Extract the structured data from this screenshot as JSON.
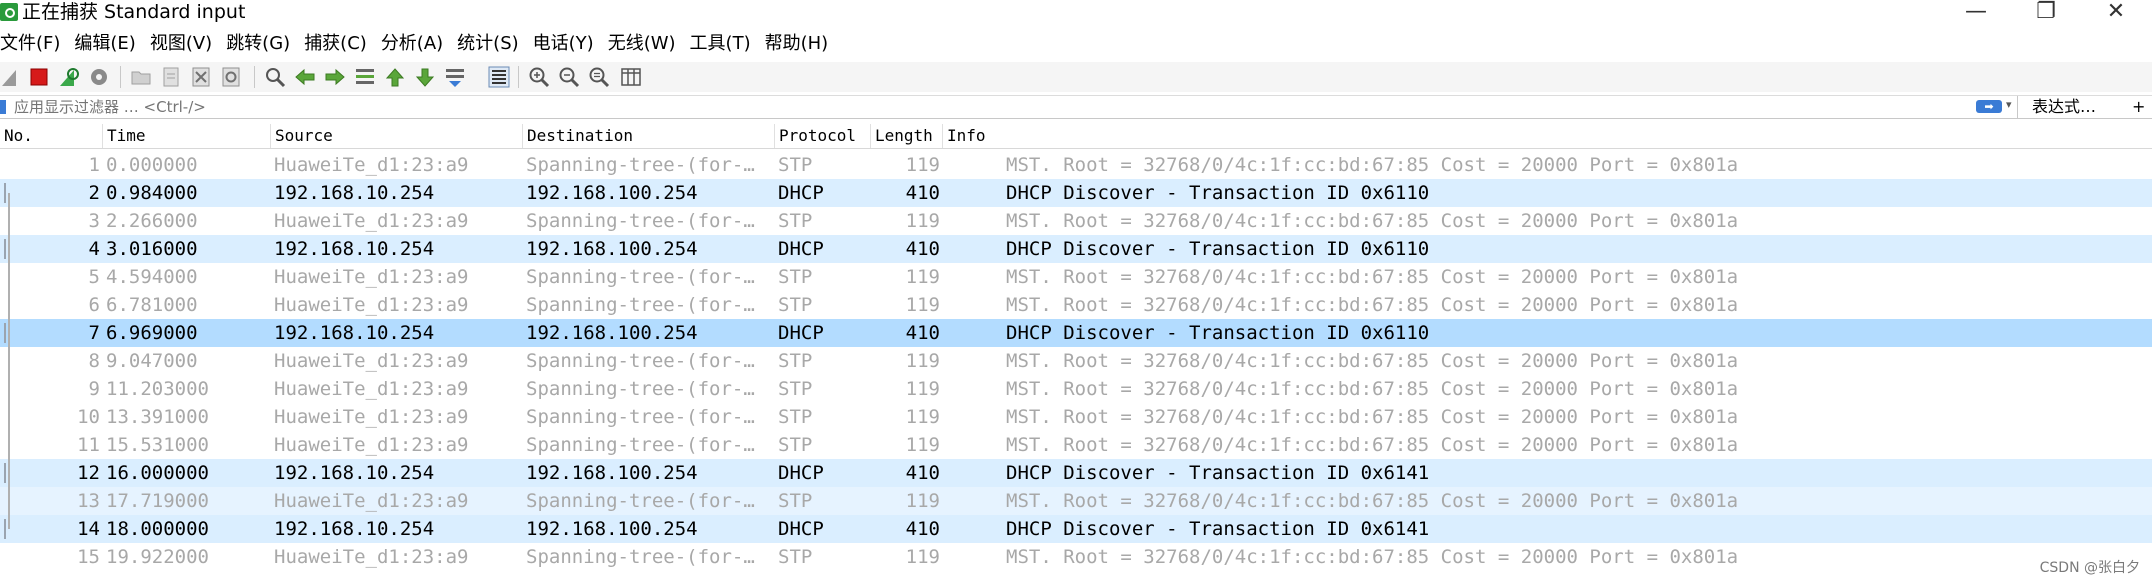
{
  "window": {
    "title": "正在捕获 Standard input",
    "min_glyph": "—",
    "max_glyph": "❐",
    "close_glyph": "✕"
  },
  "menu": [
    "文件(F)",
    "编辑(E)",
    "视图(V)",
    "跳转(G)",
    "捕获(C)",
    "分析(A)",
    "统计(S)",
    "电话(Y)",
    "无线(W)",
    "工具(T)",
    "帮助(H)"
  ],
  "toolbar": {
    "icons": [
      "shark-fin-start-icon",
      "stop-capture-icon",
      "restart-capture-icon",
      "capture-options-icon",
      "open-file-icon",
      "save-file-icon",
      "close-file-icon",
      "reload-file-icon",
      "find-packet-icon",
      "go-back-icon",
      "go-forward-icon",
      "go-to-packet-icon",
      "go-first-icon",
      "go-last-icon",
      "auto-scroll-icon",
      "colorize-icon",
      "zoom-in-icon",
      "zoom-out-icon",
      "normal-size-icon",
      "resize-columns-icon"
    ]
  },
  "filter": {
    "placeholder": "应用显示过滤器 … <Ctrl-/>",
    "expression_label": "表达式…",
    "plus_label": "+"
  },
  "columns": [
    "No.",
    "Time",
    "Source",
    "Destination",
    "Protocol",
    "Length",
    "Info"
  ],
  "packets": [
    {
      "no": "1",
      "time": "0.000000",
      "src": "HuaweiTe_d1:23:a9",
      "dst": "Spanning-tree-(for-…",
      "proto": "STP",
      "len": "119",
      "info": "MST. Root = 32768/0/4c:1f:cc:bd:67:85  Cost = 20000  Port = 0x801a",
      "kind": "stp"
    },
    {
      "no": "2",
      "time": "0.984000",
      "src": "192.168.10.254",
      "dst": "192.168.100.254",
      "proto": "DHCP",
      "len": "410",
      "info": "DHCP Discover - Transaction ID 0x6110",
      "kind": "dhcp"
    },
    {
      "no": "3",
      "time": "2.266000",
      "src": "HuaweiTe_d1:23:a9",
      "dst": "Spanning-tree-(for-…",
      "proto": "STP",
      "len": "119",
      "info": "MST. Root = 32768/0/4c:1f:cc:bd:67:85  Cost = 20000  Port = 0x801a",
      "kind": "stp"
    },
    {
      "no": "4",
      "time": "3.016000",
      "src": "192.168.10.254",
      "dst": "192.168.100.254",
      "proto": "DHCP",
      "len": "410",
      "info": "DHCP Discover - Transaction ID 0x6110",
      "kind": "dhcp"
    },
    {
      "no": "5",
      "time": "4.594000",
      "src": "HuaweiTe_d1:23:a9",
      "dst": "Spanning-tree-(for-…",
      "proto": "STP",
      "len": "119",
      "info": "MST. Root = 32768/0/4c:1f:cc:bd:67:85  Cost = 20000  Port = 0x801a",
      "kind": "stp"
    },
    {
      "no": "6",
      "time": "6.781000",
      "src": "HuaweiTe_d1:23:a9",
      "dst": "Spanning-tree-(for-…",
      "proto": "STP",
      "len": "119",
      "info": "MST. Root = 32768/0/4c:1f:cc:bd:67:85  Cost = 20000  Port = 0x801a",
      "kind": "stp"
    },
    {
      "no": "7",
      "time": "6.969000",
      "src": "192.168.10.254",
      "dst": "192.168.100.254",
      "proto": "DHCP",
      "len": "410",
      "info": "DHCP Discover - Transaction ID 0x6110",
      "kind": "selected"
    },
    {
      "no": "8",
      "time": "9.047000",
      "src": "HuaweiTe_d1:23:a9",
      "dst": "Spanning-tree-(for-…",
      "proto": "STP",
      "len": "119",
      "info": "MST. Root = 32768/0/4c:1f:cc:bd:67:85  Cost = 20000  Port = 0x801a",
      "kind": "stp"
    },
    {
      "no": "9",
      "time": "11.203000",
      "src": "HuaweiTe_d1:23:a9",
      "dst": "Spanning-tree-(for-…",
      "proto": "STP",
      "len": "119",
      "info": "MST. Root = 32768/0/4c:1f:cc:bd:67:85  Cost = 20000  Port = 0x801a",
      "kind": "stp"
    },
    {
      "no": "10",
      "time": "13.391000",
      "src": "HuaweiTe_d1:23:a9",
      "dst": "Spanning-tree-(for-…",
      "proto": "STP",
      "len": "119",
      "info": "MST. Root = 32768/0/4c:1f:cc:bd:67:85  Cost = 20000  Port = 0x801a",
      "kind": "stp"
    },
    {
      "no": "11",
      "time": "15.531000",
      "src": "HuaweiTe_d1:23:a9",
      "dst": "Spanning-tree-(for-…",
      "proto": "STP",
      "len": "119",
      "info": "MST. Root = 32768/0/4c:1f:cc:bd:67:85  Cost = 20000  Port = 0x801a",
      "kind": "stp"
    },
    {
      "no": "12",
      "time": "16.000000",
      "src": "192.168.10.254",
      "dst": "192.168.100.254",
      "proto": "DHCP",
      "len": "410",
      "info": "DHCP Discover - Transaction ID 0x6141",
      "kind": "dhcp"
    },
    {
      "no": "13",
      "time": "17.719000",
      "src": "HuaweiTe_d1:23:a9",
      "dst": "Spanning-tree-(for-…",
      "proto": "STP",
      "len": "119",
      "info": "MST. Root = 32768/0/4c:1f:cc:bd:67:85  Cost = 20000  Port = 0x801a",
      "kind": "stp-hi"
    },
    {
      "no": "14",
      "time": "18.000000",
      "src": "192.168.10.254",
      "dst": "192.168.100.254",
      "proto": "DHCP",
      "len": "410",
      "info": "DHCP Discover - Transaction ID 0x6141",
      "kind": "dhcp"
    },
    {
      "no": "15",
      "time": "19.922000",
      "src": "HuaweiTe_d1:23:a9",
      "dst": "Spanning-tree-(for-…",
      "proto": "STP",
      "len": "119",
      "info": "MST. Root = 32768/0/4c:1f:cc:bd:67:85  Cost = 20000  Port = 0x801a",
      "kind": "stp"
    }
  ],
  "watermark": "CSDN @张白夕",
  "colors": {
    "dhcp_row": "#daeeff",
    "selected_row": "#b3dcff",
    "stp_text": "#a8a8a8",
    "filter_accent": "#3a7bd5"
  }
}
